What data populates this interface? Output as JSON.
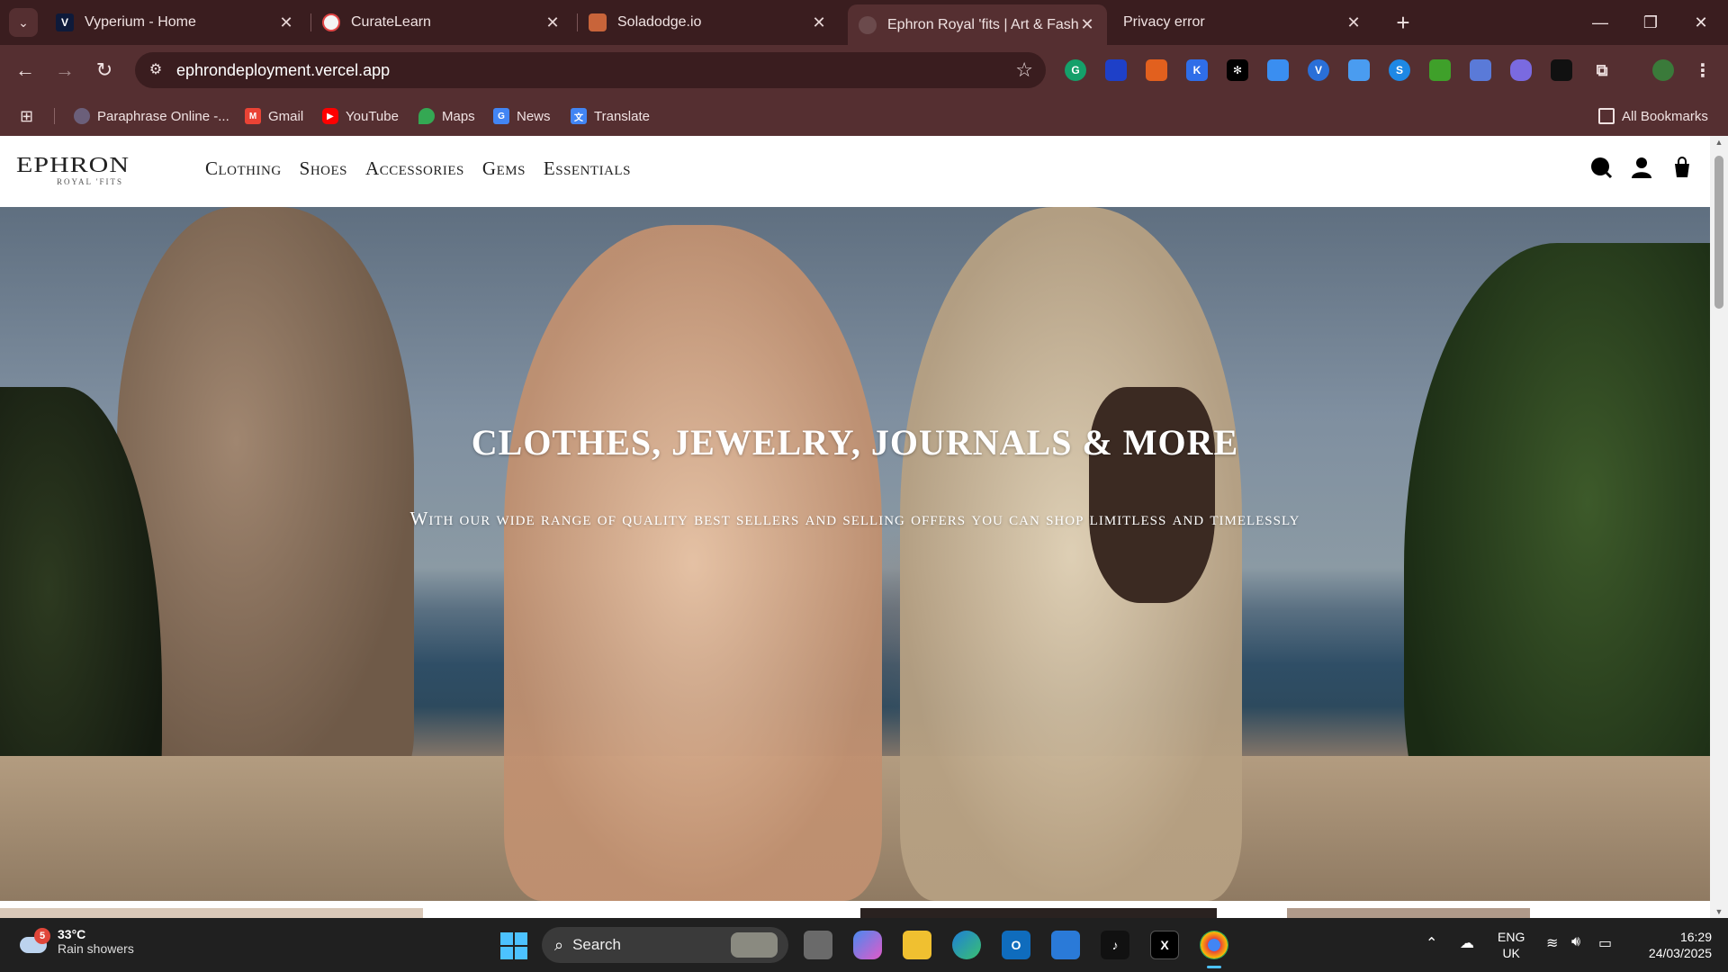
{
  "browser": {
    "tabs": [
      {
        "title": "Vyperium - Home",
        "favicon": "V",
        "favicon_color": "#0e1a3a"
      },
      {
        "title": "CurateLearn",
        "favicon": "",
        "favicon_color": "#f4f4f4"
      },
      {
        "title": "Soladodge.io",
        "favicon": "",
        "favicon_color": "#c8643a"
      },
      {
        "title": "Ephron Royal 'fits | Art & Fashio",
        "favicon": "",
        "favicon_color": "#6b4a4c"
      },
      {
        "title": "Privacy error",
        "favicon": "",
        "favicon_color": "#3a1d1f"
      }
    ],
    "active_tab_index": 3,
    "address": "ephrondeployment.vercel.app",
    "bookmarks": [
      {
        "label": "Paraphrase Online -...",
        "icon": "paraphrase-icon",
        "color": "#6b5f7a"
      },
      {
        "label": "Gmail",
        "icon": "gmail-icon",
        "color": "#ea4335"
      },
      {
        "label": "YouTube",
        "icon": "youtube-icon",
        "color": "#ff0000"
      },
      {
        "label": "Maps",
        "icon": "maps-icon",
        "color": "#34a853"
      },
      {
        "label": "News",
        "icon": "news-icon",
        "color": "#4285f4"
      },
      {
        "label": "Translate",
        "icon": "translate-icon",
        "color": "#4285f4"
      }
    ],
    "all_bookmarks": "All Bookmarks"
  },
  "site": {
    "logo_text": "EPHRON",
    "logo_subtext": "ROYAL 'FITS",
    "nav": [
      "Clothing",
      "Shoes",
      "Accessories",
      "Gems",
      "Essentials"
    ],
    "hero_title": "CLOTHES, JEWELRY, JOURNALS & MORE",
    "hero_subtitle": "With our wide range of quality best sellers and selling offers you can shop limitless and timelessly"
  },
  "taskbar": {
    "weather_badge": "5",
    "temperature": "33°C",
    "weather": "Rain showers",
    "search_label": "Search",
    "language_line1": "ENG",
    "language_line2": "UK",
    "time": "16:29",
    "date": "24/03/2025"
  }
}
